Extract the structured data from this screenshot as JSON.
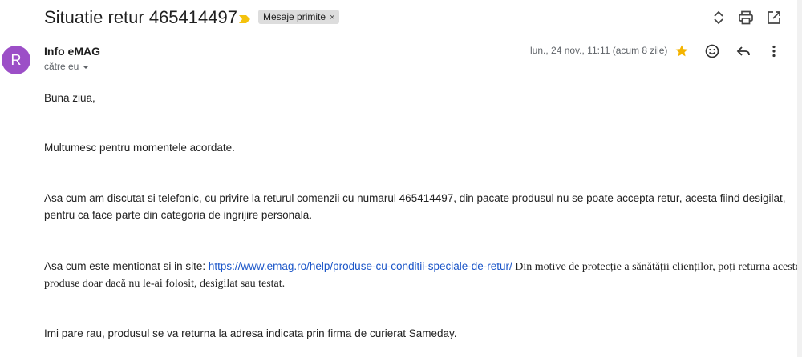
{
  "header": {
    "subject": "Situatie retur 465414497",
    "label_chip": "Mesaje primite",
    "label_close": "×"
  },
  "message": {
    "avatar_letter": "R",
    "sender": "Info eMAG",
    "to": "către eu",
    "date": "lun., 24 nov., 11:11 (acum 8 zile)"
  },
  "body": {
    "greeting": "Buna ziua,",
    "thanks": "Multumesc pentru momentele acordate.",
    "p1_line1": "Asa cum am discutat si telefonic, cu privire la returul comenzii cu numarul 465414497, din pacate produsul nu se poate accepta retur, acesta fiind desigilat,",
    "p1_line2": "pentru ca face parte din categoria de ingrijire personala.",
    "p2_prefix": "Asa cum este mentionat si in site: ",
    "p2_link": "https://www.emag.ro/help/produse-cu-conditii-speciale-de-retur/",
    "p2_quote_line1": " Din motive de protecție a sănătății clienților, poți returna aceste",
    "p2_quote_line2": "produse doar dacă nu le-ai folosit, desigilat sau testat.",
    "p3": "Imi pare rau, produsul se va returna la adresa indicata prin firma de curierat Sameday."
  },
  "colors": {
    "avatar": "#9c4fc7",
    "star": "#f4b400",
    "importance": "#f4c20d",
    "link": "#1a55c8"
  },
  "icons": [
    "importance-marker-icon",
    "expand-collapse-icon",
    "print-icon",
    "open-new-window-icon",
    "star-icon",
    "emoji-icon",
    "reply-icon",
    "more-vert-icon",
    "caret-down-icon"
  ]
}
